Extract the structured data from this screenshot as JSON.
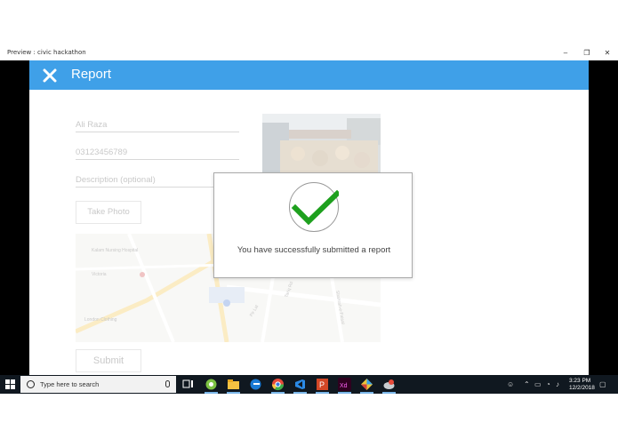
{
  "window": {
    "title": "Preview : civic hackathon",
    "controls": {
      "minimize": "–",
      "restore": "❐",
      "close": "✕"
    }
  },
  "app": {
    "header": {
      "title": "Report",
      "close_icon": "close-icon",
      "color": "#3fa0e8"
    },
    "form": {
      "name_value": "Ali Raza",
      "phone_value": "03123456789",
      "description_placeholder": "Description (optional)",
      "take_photo_label": "Take Photo",
      "submit_label": "Submit",
      "map_labels": {
        "poi1": "Kalam Nursing Hospital",
        "poi2": "Victoria",
        "poi3": "London Clothing",
        "road1": "Pir Lal",
        "road2": "Tariq Rd",
        "road3": "Shahrah-e-Faisal"
      }
    },
    "modal": {
      "icon": "checkmark-icon",
      "message": "You have successfully submitted a report",
      "check_color": "#1ea01e"
    }
  },
  "taskbar": {
    "search_placeholder": "Type here to search",
    "time": "3:23 PM",
    "date": "12/2/2018",
    "apps": [
      "task-view-icon",
      "chat-icon",
      "file-explorer-icon",
      "edge-icon",
      "chrome-icon",
      "visual-studio-icon",
      "powerpoint-icon",
      "adobe-xd-icon",
      "app-icon",
      "app2-icon"
    ]
  }
}
